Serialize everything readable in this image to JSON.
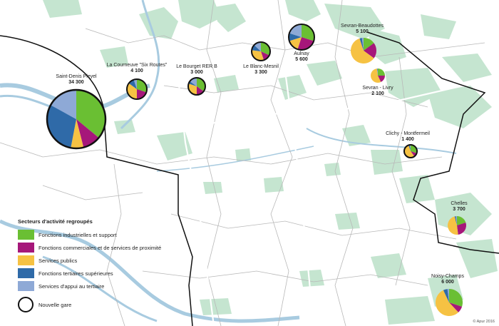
{
  "legend": {
    "title": "Secteurs d'activité regroupés",
    "items": [
      {
        "label": "Fonctions industrielles et support",
        "color": "#6abf33"
      },
      {
        "label": "Fonctions commerciales et de services de proximité",
        "color": "#a6177a"
      },
      {
        "label": "Services publics",
        "color": "#f6c243"
      },
      {
        "label": "Fonctions tertiaires supérieures",
        "color": "#2f6aa8"
      },
      {
        "label": "Services d'appui au tertiaire",
        "color": "#8ea9d6"
      }
    ],
    "gare_label": "Nouvelle gare"
  },
  "copyright": "© Apur 2016",
  "stations": [
    {
      "id": "saint-denis-pleyel",
      "name": "Saint-Denis Pleyel",
      "count": "34 300",
      "shares": [
        36,
        10,
        7,
        30,
        17
      ]
    },
    {
      "id": "la-courneuve",
      "name": "La Courneuve \"Six Routes\"",
      "count": "4 100",
      "shares": [
        30,
        20,
        35,
        10,
        5
      ]
    },
    {
      "id": "le-bourget",
      "name": "Le Bourget RER B",
      "count": "3 000",
      "shares": [
        35,
        15,
        30,
        5,
        15
      ]
    },
    {
      "id": "le-blanc-mesnil",
      "name": "Le Blanc-Mesnil",
      "count": "3 300",
      "shares": [
        32,
        13,
        32,
        10,
        13
      ]
    },
    {
      "id": "aulnay",
      "name": "Aulnay",
      "count": "5 600",
      "shares": [
        30,
        25,
        15,
        10,
        20
      ]
    },
    {
      "id": "sevran-beaudottes",
      "name": "Sevran-Beaudottes",
      "count": "5 100",
      "shares": [
        15,
        20,
        60,
        3,
        2
      ]
    },
    {
      "id": "sevran-livry",
      "name": "Sevran - Livry",
      "count": "2 100",
      "shares": [
        25,
        18,
        55,
        1,
        1
      ]
    },
    {
      "id": "clichy-montfermeil",
      "name": "Clichy - Montfermeil",
      "count": "1 400",
      "shares": [
        30,
        10,
        55,
        3,
        2
      ]
    },
    {
      "id": "chelles",
      "name": "Chelles",
      "count": "3 700",
      "shares": [
        20,
        28,
        48,
        2,
        2
      ]
    },
    {
      "id": "noisy-champs",
      "name": "Noisy-Champs",
      "count": "6 000",
      "shares": [
        30,
        8,
        55,
        5,
        2
      ]
    }
  ]
}
